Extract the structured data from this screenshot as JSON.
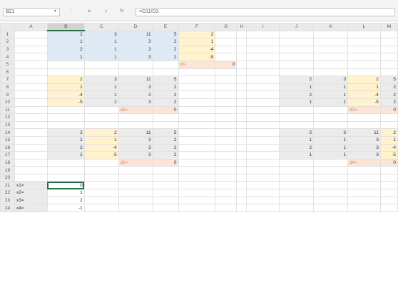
{
  "formula_bar": {
    "name_box": "B21",
    "dropdown_glyph": "▾",
    "dots": "⋮",
    "cancel": "✕",
    "enter": "✓",
    "fx": "fx",
    "formula": "=D11/D3"
  },
  "columns": [
    "A",
    "B",
    "C",
    "D",
    "E",
    "F",
    "G",
    "H",
    "I",
    "J",
    "K",
    "L",
    "M"
  ],
  "rows": [
    [
      "",
      "2",
      "3",
      "11",
      "5",
      "2",
      "",
      "",
      "",
      "",
      "",
      "",
      ""
    ],
    [
      "",
      "1",
      "1",
      "3",
      "2",
      "1",
      "",
      "",
      "",
      "",
      "",
      "",
      ""
    ],
    [
      "",
      "2",
      "1",
      "3",
      "2",
      "-4",
      "",
      "",
      "",
      "",
      "",
      "",
      ""
    ],
    [
      "",
      "1",
      "1",
      "3",
      "2",
      "-5",
      "",
      "",
      "",
      "",
      "",
      "",
      ""
    ],
    [
      "",
      "",
      "",
      "",
      "",
      "d=",
      "0",
      "",
      "",
      "",
      "",
      "",
      ""
    ],
    [
      "",
      "",
      "",
      "",
      "",
      "",
      "",
      "",
      "",
      "",
      "",
      "",
      ""
    ],
    [
      "",
      "2",
      "3",
      "11",
      "5",
      "",
      "",
      "",
      "",
      "2",
      "3",
      "2",
      "5"
    ],
    [
      "",
      "1",
      "1",
      "3",
      "2",
      "",
      "",
      "",
      "",
      "1",
      "1",
      "1",
      "2"
    ],
    [
      "",
      "-4",
      "1",
      "3",
      "2",
      "",
      "",
      "",
      "",
      "2",
      "1",
      "-4",
      "2"
    ],
    [
      "",
      "-5",
      "1",
      "3",
      "2",
      "",
      "",
      "",
      "",
      "1",
      "1",
      "-5",
      "2"
    ],
    [
      "",
      "",
      "",
      "d1=",
      "0",
      "",
      "",
      "",
      "",
      "",
      "",
      "d3=",
      "0"
    ],
    [
      "",
      "",
      "",
      "",
      "",
      "",
      "",
      "",
      "",
      "",
      "",
      "",
      ""
    ],
    [
      "",
      "",
      "",
      "",
      "",
      "",
      "",
      "",
      "",
      "",
      "",
      "",
      ""
    ],
    [
      "",
      "2",
      "2",
      "11",
      "5",
      "",
      "",
      "",
      "",
      "2",
      "3",
      "11",
      "2"
    ],
    [
      "",
      "1",
      "1",
      "3",
      "2",
      "",
      "",
      "",
      "",
      "1",
      "1",
      "3",
      "1"
    ],
    [
      "",
      "2",
      "-4",
      "3",
      "2",
      "",
      "",
      "",
      "",
      "2",
      "1",
      "3",
      "-4"
    ],
    [
      "",
      "1",
      "-5",
      "3",
      "2",
      "",
      "",
      "",
      "",
      "1",
      "1",
      "3",
      "-5"
    ],
    [
      "",
      "",
      "",
      "d2=",
      "0",
      "",
      "",
      "",
      "",
      "",
      "",
      "d4=",
      "0"
    ],
    [
      "",
      "",
      "",
      "",
      "",
      "",
      "",
      "",
      "",
      "",
      "",
      "",
      ""
    ],
    [
      "",
      "",
      "",
      "",
      "",
      "",
      "",
      "",
      "",
      "",
      "",
      "",
      ""
    ],
    [
      "x1=",
      "0",
      "",
      "",
      "",
      "",
      "",
      "",
      "",
      "",
      "",
      "",
      ""
    ],
    [
      "x2=",
      "1",
      "",
      "",
      "",
      "",
      "",
      "",
      "",
      "",
      "",
      "",
      ""
    ],
    [
      "x3=",
      "2",
      "",
      "",
      "",
      "",
      "",
      "",
      "",
      "",
      "",
      "",
      ""
    ],
    [
      "x4=",
      "-1",
      "",
      "",
      "",
      "",
      "",
      "",
      "",
      "",
      "",
      "",
      ""
    ]
  ],
  "fills": {
    "blue": "#deebf7",
    "yellow": "#fff2cc",
    "gray": "#ebebeb",
    "peach": "#fce4d6",
    "selection": "#217346"
  }
}
